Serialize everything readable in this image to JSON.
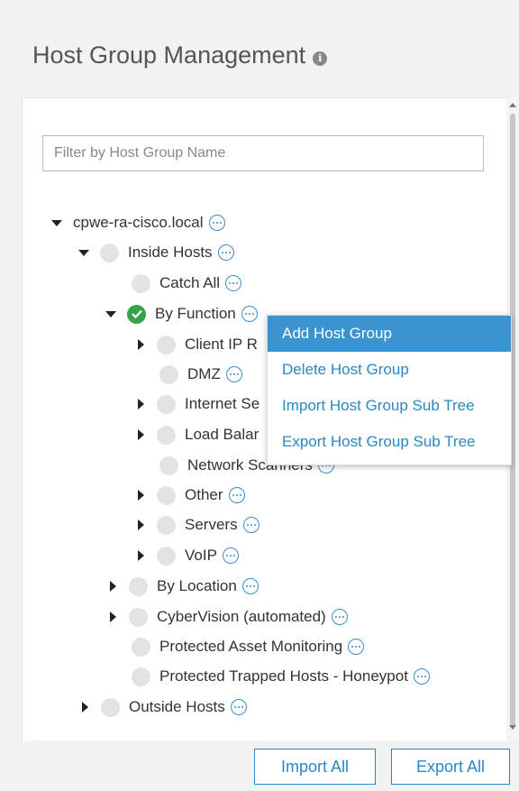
{
  "header": {
    "title": "Host Group Management",
    "info_icon": "info-icon"
  },
  "filter": {
    "placeholder": "Filter by Host Group Name",
    "value": ""
  },
  "tree": {
    "root": "cpwe-ra-cisco.local",
    "inside_hosts": "Inside Hosts",
    "catch_all": "Catch All",
    "by_function": "By Function",
    "client_ip": "Client IP R",
    "dmz": "DMZ",
    "internet": "Internet Se",
    "load_balancers": "Load Balar",
    "network_scanners": "Network Scanners",
    "other": "Other",
    "servers": "Servers",
    "voip": "VoIP",
    "by_location": "By Location",
    "cybervision": "CyberVision (automated)",
    "protected_asset": "Protected Asset Monitoring",
    "protected_trapped": "Protected Trapped Hosts - Honeypot",
    "outside_hosts": "Outside Hosts"
  },
  "context_menu": {
    "items": [
      "Add Host Group",
      "Delete Host Group",
      "Import Host Group Sub Tree",
      "Export Host Group Sub Tree"
    ]
  },
  "footer": {
    "import_label": "Import All",
    "export_label": "Export All"
  },
  "colors": {
    "accent": "#2a88c8",
    "menu_active": "#3b93d0",
    "check_green": "#36a34b"
  }
}
